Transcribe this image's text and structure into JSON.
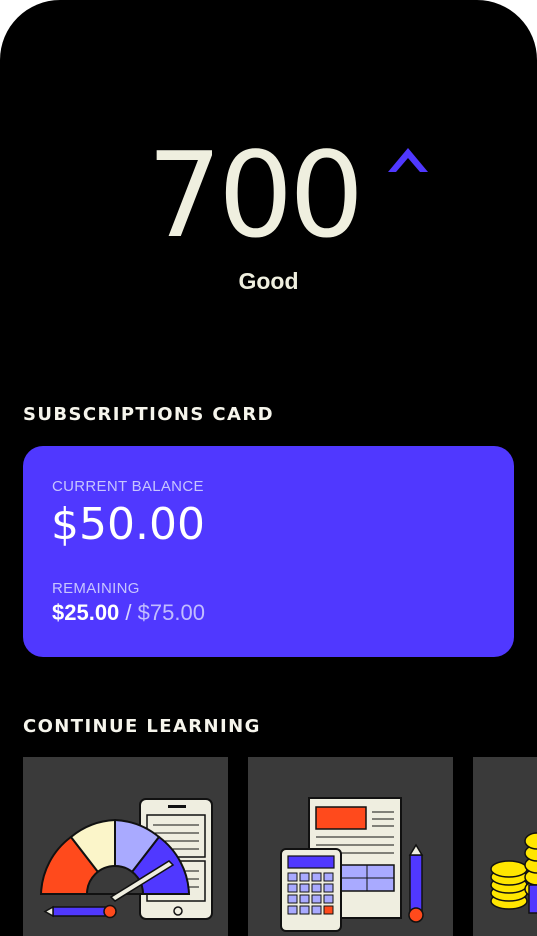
{
  "score": {
    "value": "700",
    "trend_icon": "caret-up-icon",
    "label": "Good",
    "accent": "#5038ff"
  },
  "subscriptions": {
    "section_title": "SUBSCRIPTIONS CARD",
    "balance_label": "CURRENT BALANCE",
    "balance_value": "$50.00",
    "remaining_label": "REMAINING",
    "remaining_value": "$25.00",
    "separator": " / ",
    "remaining_total": "$75.00",
    "card_color": "#5038ff"
  },
  "learning": {
    "section_title": "CONTINUE LEARNING",
    "tiles": [
      {
        "icon": "credit-score-gauge-icon"
      },
      {
        "icon": "calculator-document-icon"
      },
      {
        "icon": "coin-stack-icon"
      }
    ]
  }
}
